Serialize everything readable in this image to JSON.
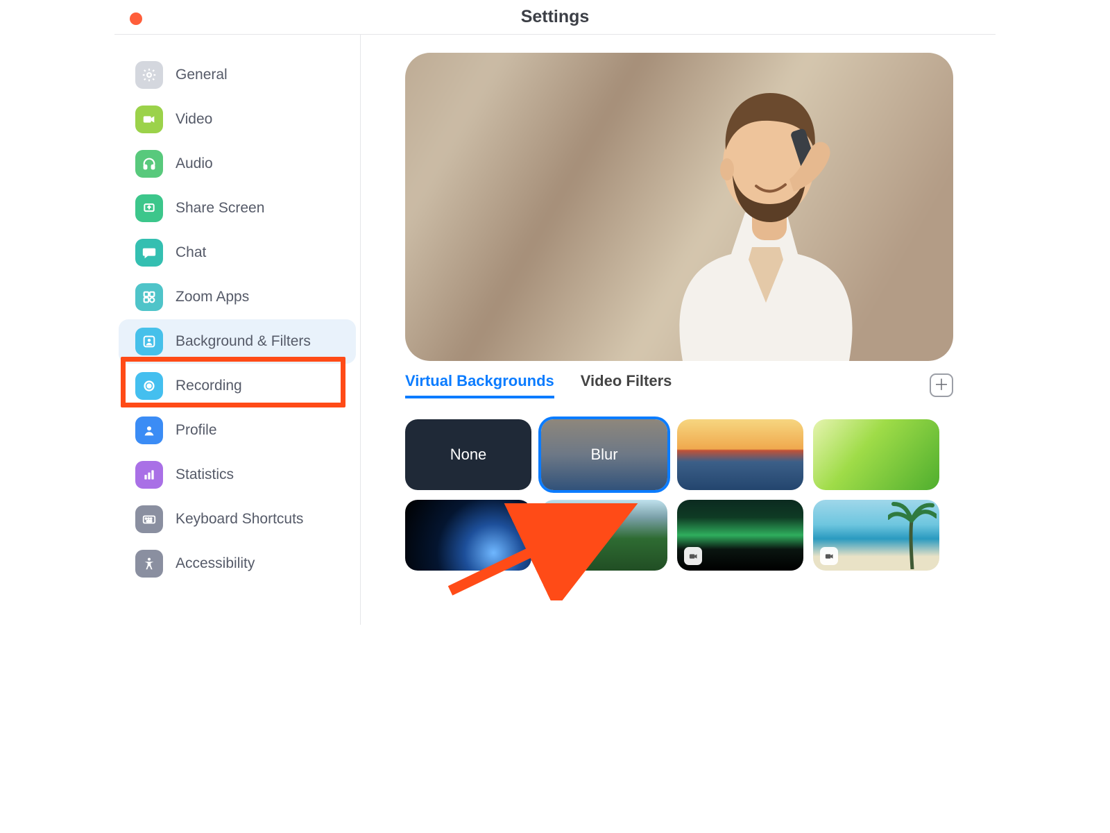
{
  "header": {
    "title": "Settings"
  },
  "sidebar": {
    "items": [
      {
        "label": "General",
        "icon": "gear-icon",
        "bg": "#d4d7de",
        "active": false
      },
      {
        "label": "Video",
        "icon": "camera-icon",
        "bg": "#9bd24a",
        "active": false
      },
      {
        "label": "Audio",
        "icon": "headphones-icon",
        "bg": "#58c97c",
        "active": false
      },
      {
        "label": "Share Screen",
        "icon": "share-up-icon",
        "bg": "#3cc68b",
        "active": false
      },
      {
        "label": "Chat",
        "icon": "chat-icon",
        "bg": "#34bfb1",
        "active": false
      },
      {
        "label": "Zoom Apps",
        "icon": "apps-icon",
        "bg": "#4fc4c9",
        "active": false
      },
      {
        "label": "Background & Filters",
        "icon": "person-box-icon",
        "bg": "#46c0ea",
        "active": true
      },
      {
        "label": "Recording",
        "icon": "record-icon",
        "bg": "#44bfef",
        "active": false
      },
      {
        "label": "Profile",
        "icon": "user-icon",
        "bg": "#3b8cf5",
        "active": false
      },
      {
        "label": "Statistics",
        "icon": "stats-icon",
        "bg": "#a970e6",
        "active": false
      },
      {
        "label": "Keyboard Shortcuts",
        "icon": "keyboard-icon",
        "bg": "#8a8fa0",
        "active": false
      },
      {
        "label": "Accessibility",
        "icon": "accessibility-icon",
        "bg": "#8a8fa0",
        "active": false
      }
    ],
    "highlight_index": 6
  },
  "main": {
    "tabs": [
      {
        "label": "Virtual Backgrounds",
        "active": true
      },
      {
        "label": "Video Filters",
        "active": false
      }
    ],
    "backgrounds": [
      {
        "label": "None",
        "kind": "none",
        "selected": false
      },
      {
        "label": "Blur",
        "kind": "blur",
        "selected": true
      },
      {
        "label": "",
        "kind": "bridge",
        "selected": false
      },
      {
        "label": "",
        "kind": "grass",
        "selected": false
      },
      {
        "label": "",
        "kind": "earth",
        "selected": false
      },
      {
        "label": "",
        "kind": "park",
        "selected": false
      },
      {
        "label": "",
        "kind": "aurora",
        "selected": false,
        "video": true
      },
      {
        "label": "",
        "kind": "beach",
        "selected": false,
        "video": true
      }
    ]
  },
  "colors": {
    "accent": "#0b7cff",
    "highlight": "#ff4b17"
  }
}
